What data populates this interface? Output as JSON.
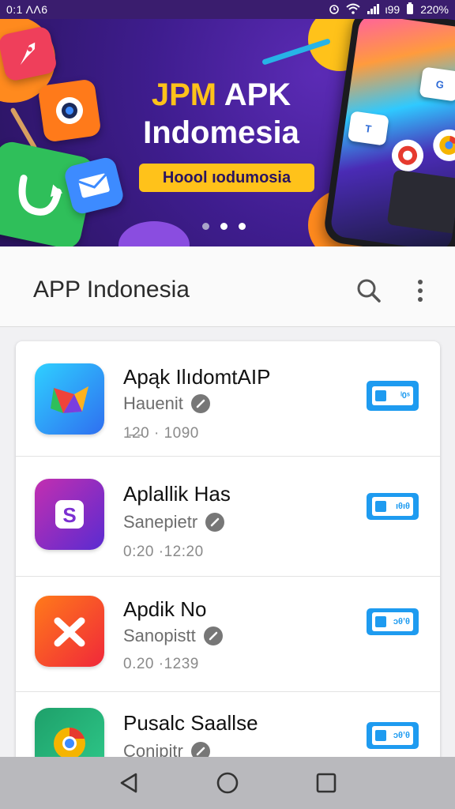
{
  "status_bar": {
    "time": "0:1 ΛΛ6",
    "battery_text": "220%",
    "net_text": "ι99"
  },
  "banner": {
    "title_line1_accent": "JPM",
    "title_line1_rest": " APK",
    "title_line2": "Indomesia",
    "tag": "Hoool ıodumosia",
    "phone_chip_texts": [
      "G",
      "T"
    ],
    "slides_total": 3,
    "active_slide": 2
  },
  "app_bar": {
    "title": "APP Indonesia",
    "icons": [
      "search-icon",
      "more-vert-icon"
    ]
  },
  "apps": [
    {
      "name": "Apąk IlıdomtAIP",
      "sub": "Hauenit",
      "meta": "1̵2̵0 · 1090",
      "btn": "ˡ0ˢ",
      "icon_color": "#2f8cf0"
    },
    {
      "name": "Aplallik Has",
      "sub": "Sanepietr",
      "meta": "0:20 ·12:20",
      "btn": "ıθıθ",
      "icon_color": "#7b2fd1"
    },
    {
      "name": "Apdik No",
      "sub": "Sanopistt",
      "meta": "0.20 ·1239",
      "btn": "ɔθʼθ",
      "icon_color": "#ff5a26"
    },
    {
      "name": "Pusalc Saallse",
      "sub": "Conipitr",
      "meta": "",
      "btn": "ɔθʼθ",
      "icon_color": "#1ea06a"
    }
  ],
  "nav": {
    "items": [
      "back-icon",
      "home-icon",
      "recents-icon"
    ]
  },
  "colors": {
    "banner_bg": "#3f1d8f",
    "accent_yellow": "#ffc21a",
    "button_blue": "#1e9bf0"
  }
}
